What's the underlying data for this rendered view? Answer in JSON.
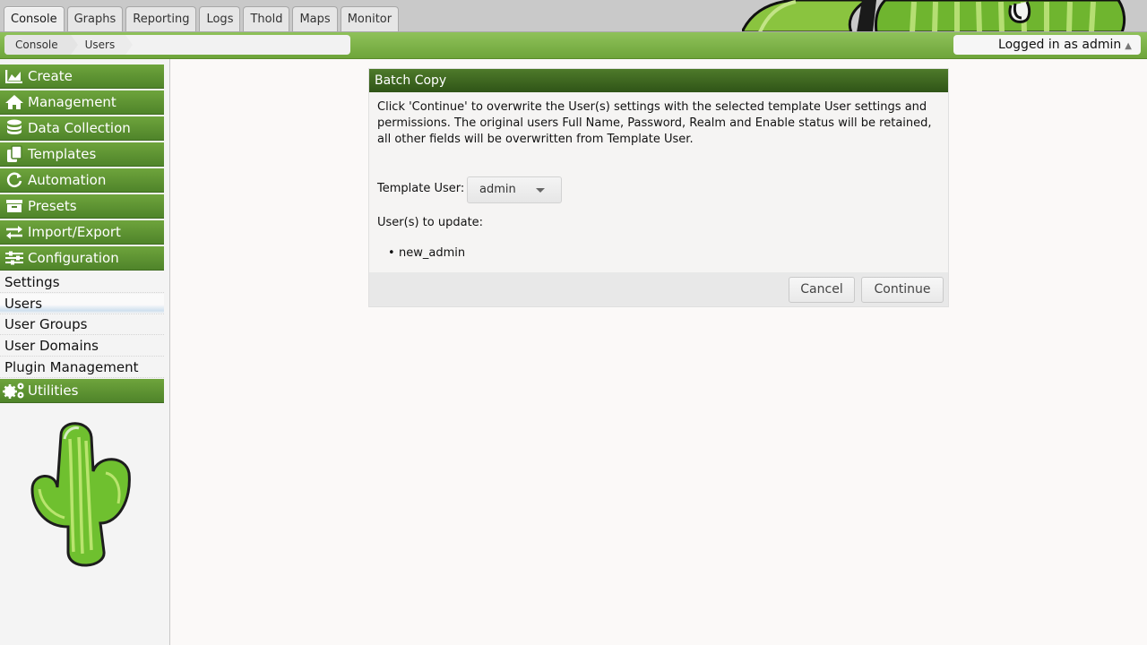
{
  "tabs": [
    "Console",
    "Graphs",
    "Reporting",
    "Logs",
    "Thold",
    "Maps",
    "Monitor"
  ],
  "breadcrumb": [
    "Console",
    "Users"
  ],
  "user_status": "Logged in as admin",
  "sidebar": {
    "headers": [
      "Create",
      "Management",
      "Data Collection",
      "Templates",
      "Automation",
      "Presets",
      "Import/Export",
      "Configuration",
      "Utilities"
    ],
    "config_items": [
      "Settings",
      "Users",
      "User Groups",
      "User Domains",
      "Plugin Management"
    ],
    "selected_item": "Users"
  },
  "dialog": {
    "title": "Batch Copy",
    "description": "Click 'Continue' to overwrite the User(s) settings with the selected template User settings and permissions. The original users Full Name, Password, Realm and Enable status will be retained, all other fields will be overwritten from Template User.",
    "template_label": "Template User:",
    "template_value": "admin",
    "update_label": "User(s) to update:",
    "users": [
      "new_admin"
    ],
    "cancel_label": "Cancel",
    "continue_label": "Continue"
  },
  "colors": {
    "menu_green": "#5a8f30",
    "title_green": "#3b6320",
    "crumb_green": "#80b54a"
  },
  "icons": [
    "chart-icon",
    "home-icon",
    "database-icon",
    "copy-icon",
    "refresh-icon",
    "archive-icon",
    "swap-icon",
    "sliders-icon",
    "cogs-icon"
  ]
}
